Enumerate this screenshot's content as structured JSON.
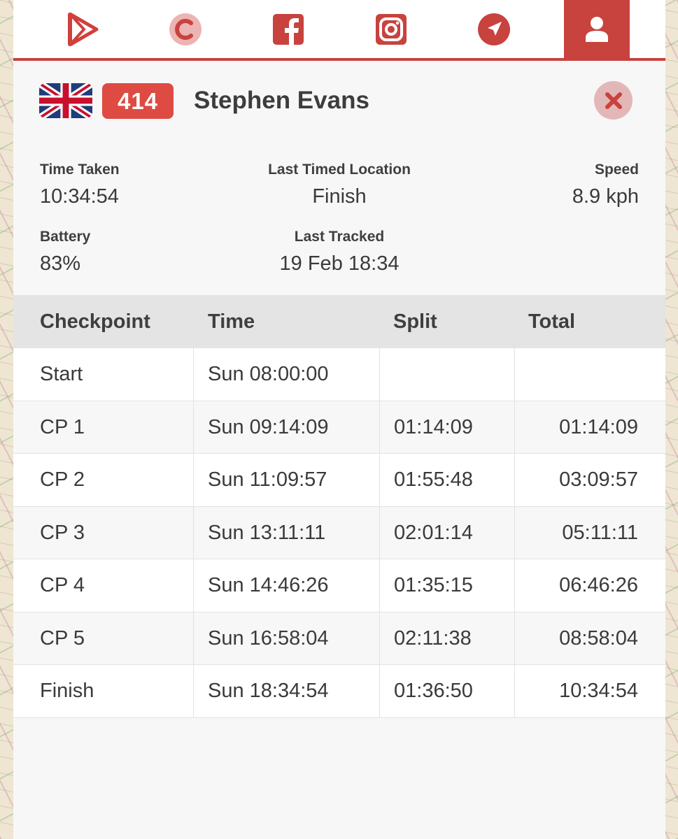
{
  "nav": {
    "items": [
      {
        "icon": "play-store-icon",
        "active": false
      },
      {
        "icon": "c-logo-icon",
        "active": false
      },
      {
        "icon": "facebook-icon",
        "active": false
      },
      {
        "icon": "instagram-icon",
        "active": false
      },
      {
        "icon": "location-arrow-icon",
        "active": false
      },
      {
        "icon": "user-icon",
        "active": true
      }
    ]
  },
  "runner": {
    "flag": "united-kingdom-flag",
    "bib": "414",
    "name": "Stephen Evans"
  },
  "stats": {
    "time_taken": {
      "label": "Time Taken",
      "value": "10:34:54"
    },
    "last_timed_location": {
      "label": "Last Timed Location",
      "value": "Finish"
    },
    "speed": {
      "label": "Speed",
      "value": "8.9 kph"
    },
    "battery": {
      "label": "Battery",
      "value": "83%"
    },
    "last_tracked": {
      "label": "Last Tracked",
      "value": "19 Feb 18:34"
    }
  },
  "table": {
    "headers": {
      "checkpoint": "Checkpoint",
      "time": "Time",
      "split": "Split",
      "total": "Total"
    },
    "rows": [
      {
        "checkpoint": "Start",
        "time": "Sun 08:00:00",
        "split": "",
        "total": ""
      },
      {
        "checkpoint": "CP 1",
        "time": "Sun 09:14:09",
        "split": "01:14:09",
        "total": "01:14:09"
      },
      {
        "checkpoint": "CP 2",
        "time": "Sun 11:09:57",
        "split": "01:55:48",
        "total": "03:09:57"
      },
      {
        "checkpoint": "CP 3",
        "time": "Sun 13:11:11",
        "split": "02:01:14",
        "total": "05:11:11"
      },
      {
        "checkpoint": "CP 4",
        "time": "Sun 14:46:26",
        "split": "01:35:15",
        "total": "06:46:26"
      },
      {
        "checkpoint": "CP 5",
        "time": "Sun 16:58:04",
        "split": "02:11:38",
        "total": "08:58:04"
      },
      {
        "checkpoint": "Finish",
        "time": "Sun 18:34:54",
        "split": "01:36:50",
        "total": "10:34:54"
      }
    ]
  },
  "colors": {
    "accent": "#c8423e",
    "bib_bg": "#dd4b42",
    "header_row_bg": "#e4e4e4",
    "close_bg": "#e3b7b8"
  }
}
